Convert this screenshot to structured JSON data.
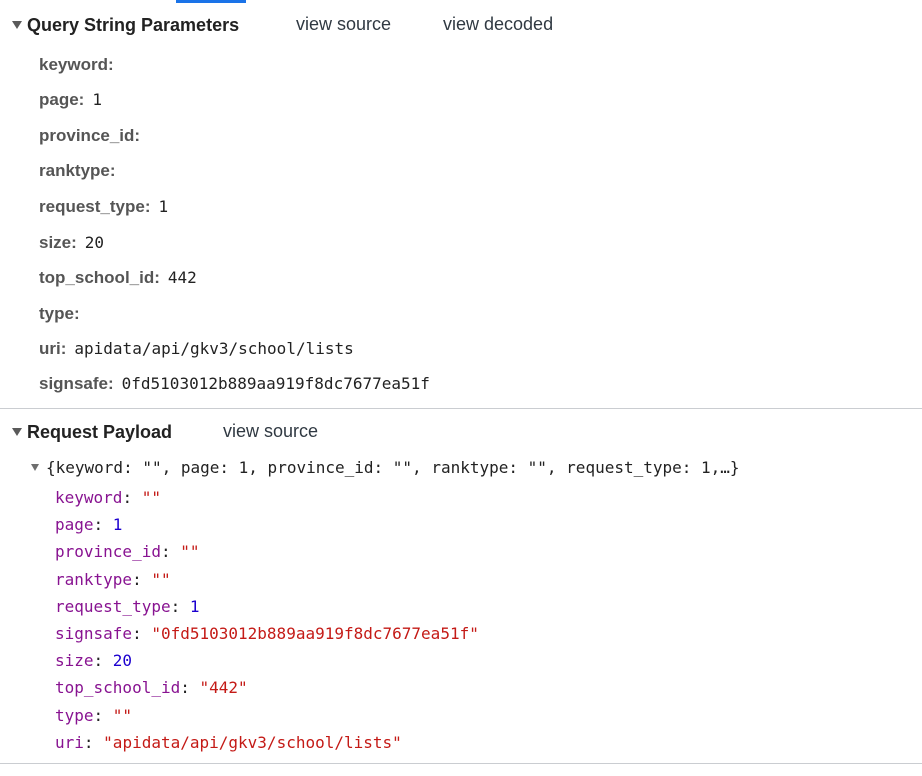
{
  "query_section": {
    "title": "Query String Parameters",
    "view_source": "view source",
    "view_decoded": "view decoded",
    "params": [
      {
        "key": "keyword:",
        "value": ""
      },
      {
        "key": "page:",
        "value": "1"
      },
      {
        "key": "province_id:",
        "value": ""
      },
      {
        "key": "ranktype:",
        "value": ""
      },
      {
        "key": "request_type:",
        "value": "1"
      },
      {
        "key": "size:",
        "value": "20"
      },
      {
        "key": "top_school_id:",
        "value": "442"
      },
      {
        "key": "type:",
        "value": ""
      },
      {
        "key": "uri:",
        "value": "apidata/api/gkv3/school/lists"
      },
      {
        "key": "signsafe:",
        "value": "0fd5103012b889aa919f8dc7677ea51f"
      }
    ]
  },
  "payload_section": {
    "title": "Request Payload",
    "view_source": "view source",
    "summary": "{keyword: \"\", page: 1, province_id: \"\", ranktype: \"\", request_type: 1,…}",
    "entries": [
      {
        "key": "keyword",
        "value": "\"\"",
        "kind": "string"
      },
      {
        "key": "page",
        "value": "1",
        "kind": "number"
      },
      {
        "key": "province_id",
        "value": "\"\"",
        "kind": "string"
      },
      {
        "key": "ranktype",
        "value": "\"\"",
        "kind": "string"
      },
      {
        "key": "request_type",
        "value": "1",
        "kind": "number"
      },
      {
        "key": "signsafe",
        "value": "\"0fd5103012b889aa919f8dc7677ea51f\"",
        "kind": "string"
      },
      {
        "key": "size",
        "value": "20",
        "kind": "number"
      },
      {
        "key": "top_school_id",
        "value": "\"442\"",
        "kind": "string"
      },
      {
        "key": "type",
        "value": "\"\"",
        "kind": "string"
      },
      {
        "key": "uri",
        "value": "\"apidata/api/gkv3/school/lists\"",
        "kind": "string"
      }
    ]
  },
  "colors": {
    "key_purple": "#881391",
    "string_red": "#c41a16",
    "number_blue": "#1c00cf",
    "accent_blue": "#1a73e8"
  }
}
